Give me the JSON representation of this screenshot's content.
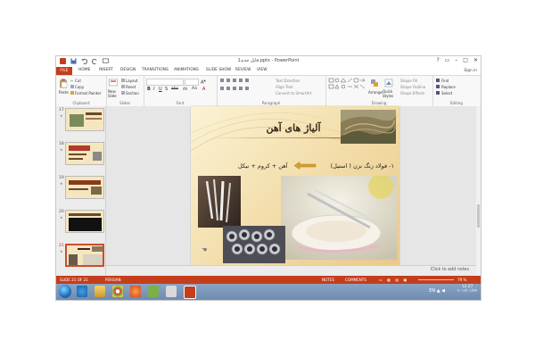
{
  "window": {
    "title": "فایل جدید1.pptx - PowerPoint",
    "help": "?",
    "minimize": "–",
    "restore": "□",
    "close": "✕"
  },
  "tabs": [
    "FILE",
    "HOME",
    "INSERT",
    "DESIGN",
    "TRANSITIONS",
    "ANIMATIONS",
    "SLIDE SHOW",
    "REVIEW",
    "VIEW"
  ],
  "sign_in": "Sign in",
  "ribbon": {
    "clipboard": {
      "label": "Clipboard",
      "paste": "Paste",
      "cut": "Cut",
      "copy": "Copy",
      "format_painter": "Format Painter"
    },
    "slides": {
      "label": "Slides",
      "new_slide": "New Slide",
      "layout": "Layout",
      "reset": "Reset",
      "section": "Section"
    },
    "font": {
      "label": "Font"
    },
    "paragraph": {
      "label": "Paragraph",
      "text_direction": "Text Direction",
      "align_text": "Align Text",
      "convert_smartart": "Convert to SmartArt"
    },
    "drawing": {
      "label": "Drawing",
      "arrange": "Arrange",
      "quick_styles": "Quick Styles",
      "shape_fill": "Shape Fill",
      "shape_outline": "Shape Outline",
      "shape_effects": "Shape Effects"
    },
    "editing": {
      "label": "Editing",
      "find": "Find",
      "replace": "Replace",
      "select": "Select"
    }
  },
  "thumbnails": [
    {
      "num": "17",
      "star": "★",
      "selected": false
    },
    {
      "num": "18",
      "star": "★",
      "selected": false
    },
    {
      "num": "19",
      "star": "★",
      "selected": false
    },
    {
      "num": "20",
      "star": "★",
      "selected": false
    },
    {
      "num": "21",
      "star": "★",
      "selected": true
    }
  ],
  "slide": {
    "title": "آلیاژ های آهن",
    "bullet": "۱- فولاد زنگ نزن ( استیل)",
    "alloy": "آهن + کروم + نیکل",
    "hand": "☚"
  },
  "notes_placeholder": "Click to add notes",
  "status": {
    "slide": "SLIDE 21 OF 21",
    "lang": "PERSIAN",
    "notes": "NOTES",
    "comments": "COMMENTS",
    "zoom": "79 %"
  },
  "tray": {
    "lang": "EN",
    "time": "12:27",
    "date": "۲۰۱۶/۰۱/۲۳"
  },
  "colors": {
    "accent": "#c43e1c",
    "taskbar": "#7b96ba",
    "slide_bg": "#f3deab"
  }
}
